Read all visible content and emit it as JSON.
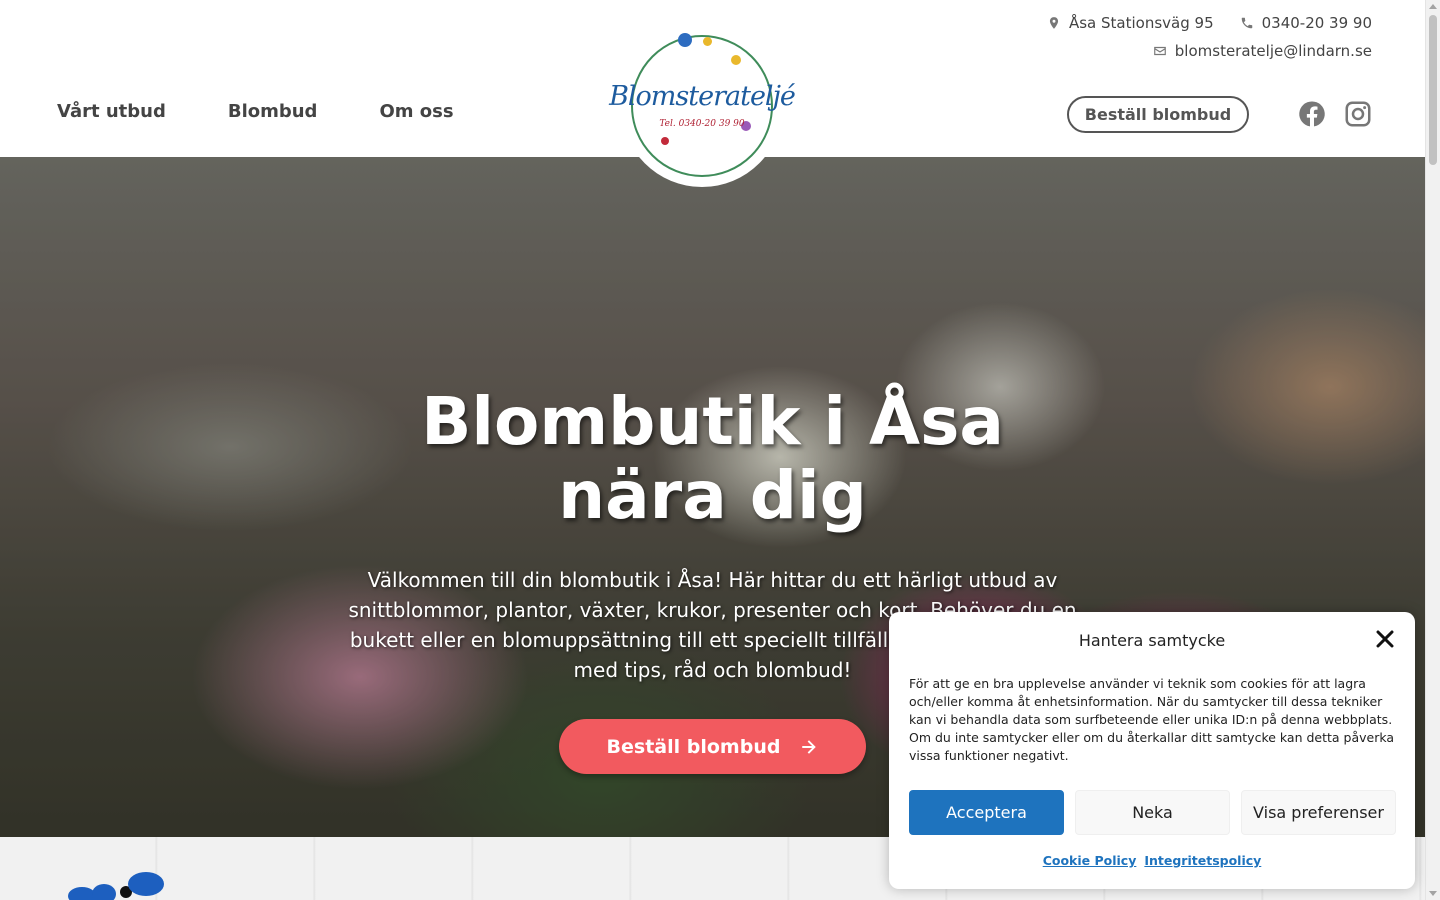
{
  "header": {
    "address": "Åsa Stationsväg 95",
    "phone": "0340-20 39 90",
    "email": "blomsteratelje@lindarn.se",
    "nav": [
      "Vårt utbud",
      "Blombud",
      "Om oss"
    ],
    "logo_text": "Blomsterateljé",
    "logo_tel": "Tel. 0340-20 39 90",
    "cta_label": "Beställ blombud",
    "social_icons": [
      "facebook-icon",
      "instagram-icon"
    ]
  },
  "hero": {
    "title": "Blombutik i Åsa nära dig",
    "description": "Välkommen till din blombutik i Åsa! Här hittar du ett härligt utbud av snittblommor, plantor, växter, krukor, presenter och kort. Behöver du en bukett eller en blomuppsättning till ett speciellt tillfälle? Vi står till tjänst med tips, råd och blombud!",
    "button_label": "Beställ blombud"
  },
  "cookie": {
    "title": "Hantera samtycke",
    "body": "För att ge en bra upplevelse använder vi teknik som cookies för att lagra och/eller komma åt enhetsinformation. När du samtycker till dessa tekniker kan vi behandla data som surfbeteende eller unika ID:n på denna webbplats. Om du inte samtycker eller om du återkallar ditt samtycke kan detta påverka vissa funktioner negativt.",
    "accept_label": "Acceptera",
    "deny_label": "Neka",
    "prefs_label": "Visa preferenser",
    "cookie_policy_label": "Cookie Policy",
    "privacy_policy_label": "Integritetspolicy"
  },
  "colors": {
    "accent_red": "#f25a5f",
    "accept_blue": "#1e73be",
    "logo_blue": "#1d5b9e"
  }
}
